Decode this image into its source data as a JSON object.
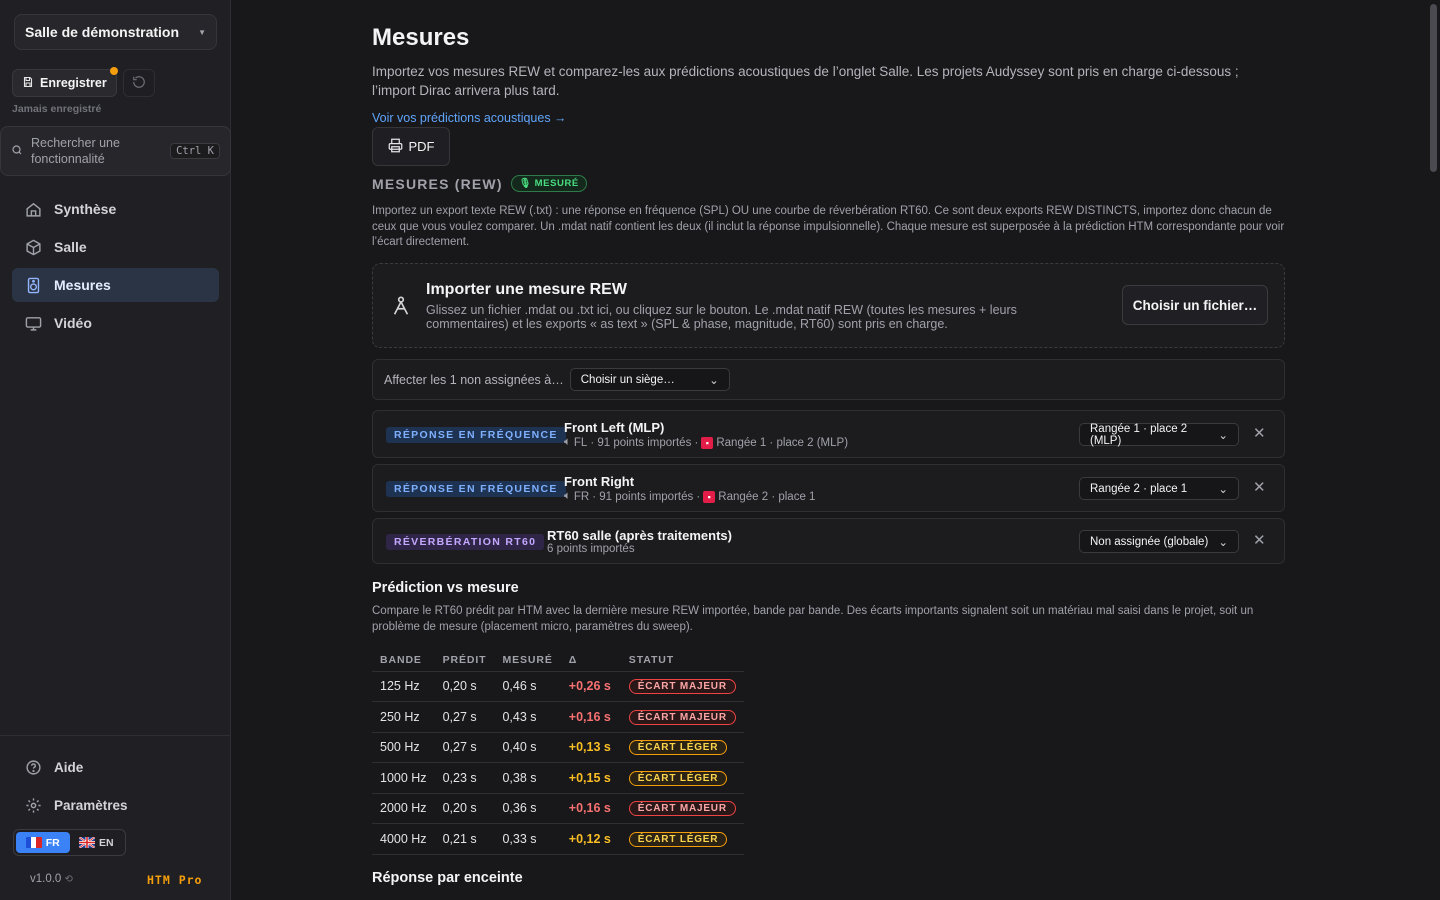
{
  "sidebar": {
    "room": "Salle de démonstration",
    "save_label": "Enregistrer",
    "save_status": "Jamais enregistré",
    "search_placeholder": "Rechercher une fonctionnalité",
    "search_shortcut": "Ctrl K",
    "nav": [
      {
        "label": "Synthèse",
        "icon": "home-icon",
        "active": false
      },
      {
        "label": "Salle",
        "icon": "cube-icon",
        "active": false
      },
      {
        "label": "Mesures",
        "icon": "speaker-icon",
        "active": true
      },
      {
        "label": "Vidéo",
        "icon": "monitor-icon",
        "active": false
      }
    ],
    "help_label": "Aide",
    "settings_label": "Paramètres",
    "lang_fr": "FR",
    "lang_en": "EN",
    "version": "v1.0.0",
    "brand": "HTM Pro"
  },
  "main": {
    "title": "Mesures",
    "intro": "Importez vos mesures REW et comparez-les aux prédictions acoustiques de l’onglet Salle. Les projets Audyssey sont pris en charge ci-dessous ; l’import Dirac arrivera plus tard.",
    "pred_link": "Voir vos prédictions acoustiques →",
    "pdf_label": "PDF",
    "section_title": "MESURES (REW)",
    "measured_badge": "MESURÉ",
    "section_desc": "Importez un export texte REW (.txt) : une réponse en fréquence (SPL) OU une courbe de réverbération RT60. Ce sont deux exports REW DISTINCTS, importez donc chacun de ceux que vous voulez comparer. Un .mdat natif contient les deux (il inclut la réponse impulsionnelle). Chaque mesure est superposée à la prédiction HTM correspondante pour voir l’écart directement.",
    "import_title": "Importer une mesure REW",
    "import_sub": "Glissez un fichier .mdat ou .txt ici, ou cliquez sur le bouton. Le .mdat natif REW (toutes les mesures + leurs commentaires) et les exports « as text » (SPL & phase, magnitude, RT60) sont pris en charge.",
    "choose_file": "Choisir un fichier…",
    "assign_label": "Affecter les 1 non assignées à…",
    "assign_select": "Choisir un siège…",
    "measurements": [
      {
        "tag": "RÉPONSE EN FRÉQUENCE",
        "name": "Front Left (MLP)",
        "channel": "FL",
        "points": "· 91 points importés ·",
        "seat": "Rangée 1 · place 2 (MLP)",
        "select": "Rangée 1 · place 2 (MLP)"
      },
      {
        "tag": "RÉPONSE EN FRÉQUENCE",
        "name": "Front Right",
        "channel": "FR",
        "points": "· 91 points importés ·",
        "seat": "Rangée 2 · place 1",
        "select": "Rangée 2 · place 1"
      },
      {
        "tag": "RÉVERBÉRATION RT60",
        "name": "RT60 salle (après traitements)",
        "points": "6 points importés",
        "select": "Non assignée (globale)"
      }
    ],
    "close_glyph": "✕",
    "pred_title": "Prédiction vs mesure",
    "pred_desc": "Compare le RT60 prédit par HTM avec la dernière mesure REW importée, bande par bande. Des écarts importants signalent soit un matériau mal saisi dans le projet, soit un problème de mesure (placement micro, paramètres du sweep).",
    "table": {
      "headers": [
        "BANDE",
        "PRÉDIT",
        "MESURÉ",
        "Δ",
        "STATUT"
      ],
      "rows": [
        {
          "band": "125 Hz",
          "pred": "0,20 s",
          "meas": "0,46 s",
          "delta": "+0,26 s",
          "status": "ÉCART MAJEUR",
          "level": "major"
        },
        {
          "band": "250 Hz",
          "pred": "0,27 s",
          "meas": "0,43 s",
          "delta": "+0,16 s",
          "status": "ÉCART MAJEUR",
          "level": "major"
        },
        {
          "band": "500 Hz",
          "pred": "0,27 s",
          "meas": "0,40 s",
          "delta": "+0,13 s",
          "status": "ÉCART LÉGER",
          "level": "minor"
        },
        {
          "band": "1000 Hz",
          "pred": "0,23 s",
          "meas": "0,38 s",
          "delta": "+0,15 s",
          "status": "ÉCART LÉGER",
          "level": "minor"
        },
        {
          "band": "2000 Hz",
          "pred": "0,20 s",
          "meas": "0,36 s",
          "delta": "+0,16 s",
          "status": "ÉCART MAJEUR",
          "level": "major"
        },
        {
          "band": "4000 Hz",
          "pred": "0,21 s",
          "meas": "0,33 s",
          "delta": "+0,12 s",
          "status": "ÉCART LÉGER",
          "level": "minor"
        }
      ]
    },
    "next_title": "Réponse par enceinte"
  }
}
